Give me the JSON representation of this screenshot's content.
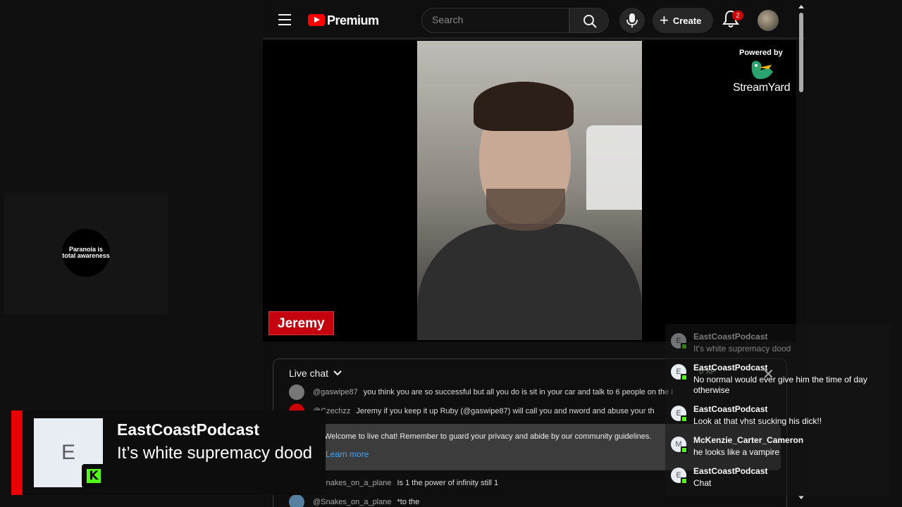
{
  "left_tile": {
    "logo_line1": "Paranoia is",
    "logo_line2": "total awareness"
  },
  "youtube": {
    "brand": "Premium",
    "search": {
      "placeholder": "Search"
    },
    "create_label": "Create",
    "notification_count": "2",
    "icons": [
      "menu-icon",
      "youtube-logo-icon",
      "search-icon",
      "mic-icon",
      "plus-icon",
      "bell-icon"
    ]
  },
  "video": {
    "name_tag": "Jeremy",
    "powered_by": "Powered by",
    "streamyard": "StreamYard"
  },
  "live_chat": {
    "title": "Live chat",
    "messages": [
      {
        "author": "@gaswipe87",
        "text": "you think you are so successful but all you do is sit in your car and talk to 6 people on the i",
        "avatar_color": "#777777"
      },
      {
        "author": "@Czechzz",
        "text": "Jeremy if you keep it up Ruby (@gaswipe87) will call you and nword and abuse your th",
        "avatar_color": "#cc0000"
      }
    ],
    "welcome": "Welcome to live chat! Remember to guard your privacy and abide by our community guidelines.",
    "learn_more": "Learn more",
    "more_messages": [
      {
        "author": "@Snakes_on_a_plane",
        "text": "Is 1 the power of infinity still 1",
        "avatar_color": "#333333"
      },
      {
        "author": "@Snakes_on_a_plane",
        "text": "*to the",
        "avatar_color": "#5580a0"
      }
    ]
  },
  "overlay_chat": {
    "messages": [
      {
        "initial": "E",
        "author": "EastCoastPodcast",
        "text": "It's white supremacy dood",
        "faded": true
      },
      {
        "initial": "E",
        "author": "EastCoastPodcast",
        "text": "No normal would ever give him the time of day otherwise",
        "faded": false
      },
      {
        "initial": "E",
        "author": "EastCoastPodcast",
        "text": "Look at that vhst sucking his dick!!",
        "faded": false
      },
      {
        "initial": "M",
        "author": "McKenzie_Carter_Cameron",
        "text": "he looks like a vampire",
        "faded": false
      },
      {
        "initial": "E",
        "author": "EastCoastPodcast",
        "text": "Chat",
        "faded": false
      }
    ],
    "badge": "0 XP"
  },
  "notification": {
    "initial": "E",
    "author": "EastCoastPodcast",
    "text": "It’s white supremacy dood",
    "kick_letter": "K",
    "accent_color": "#e90000",
    "kick_color": "#53fc18"
  }
}
